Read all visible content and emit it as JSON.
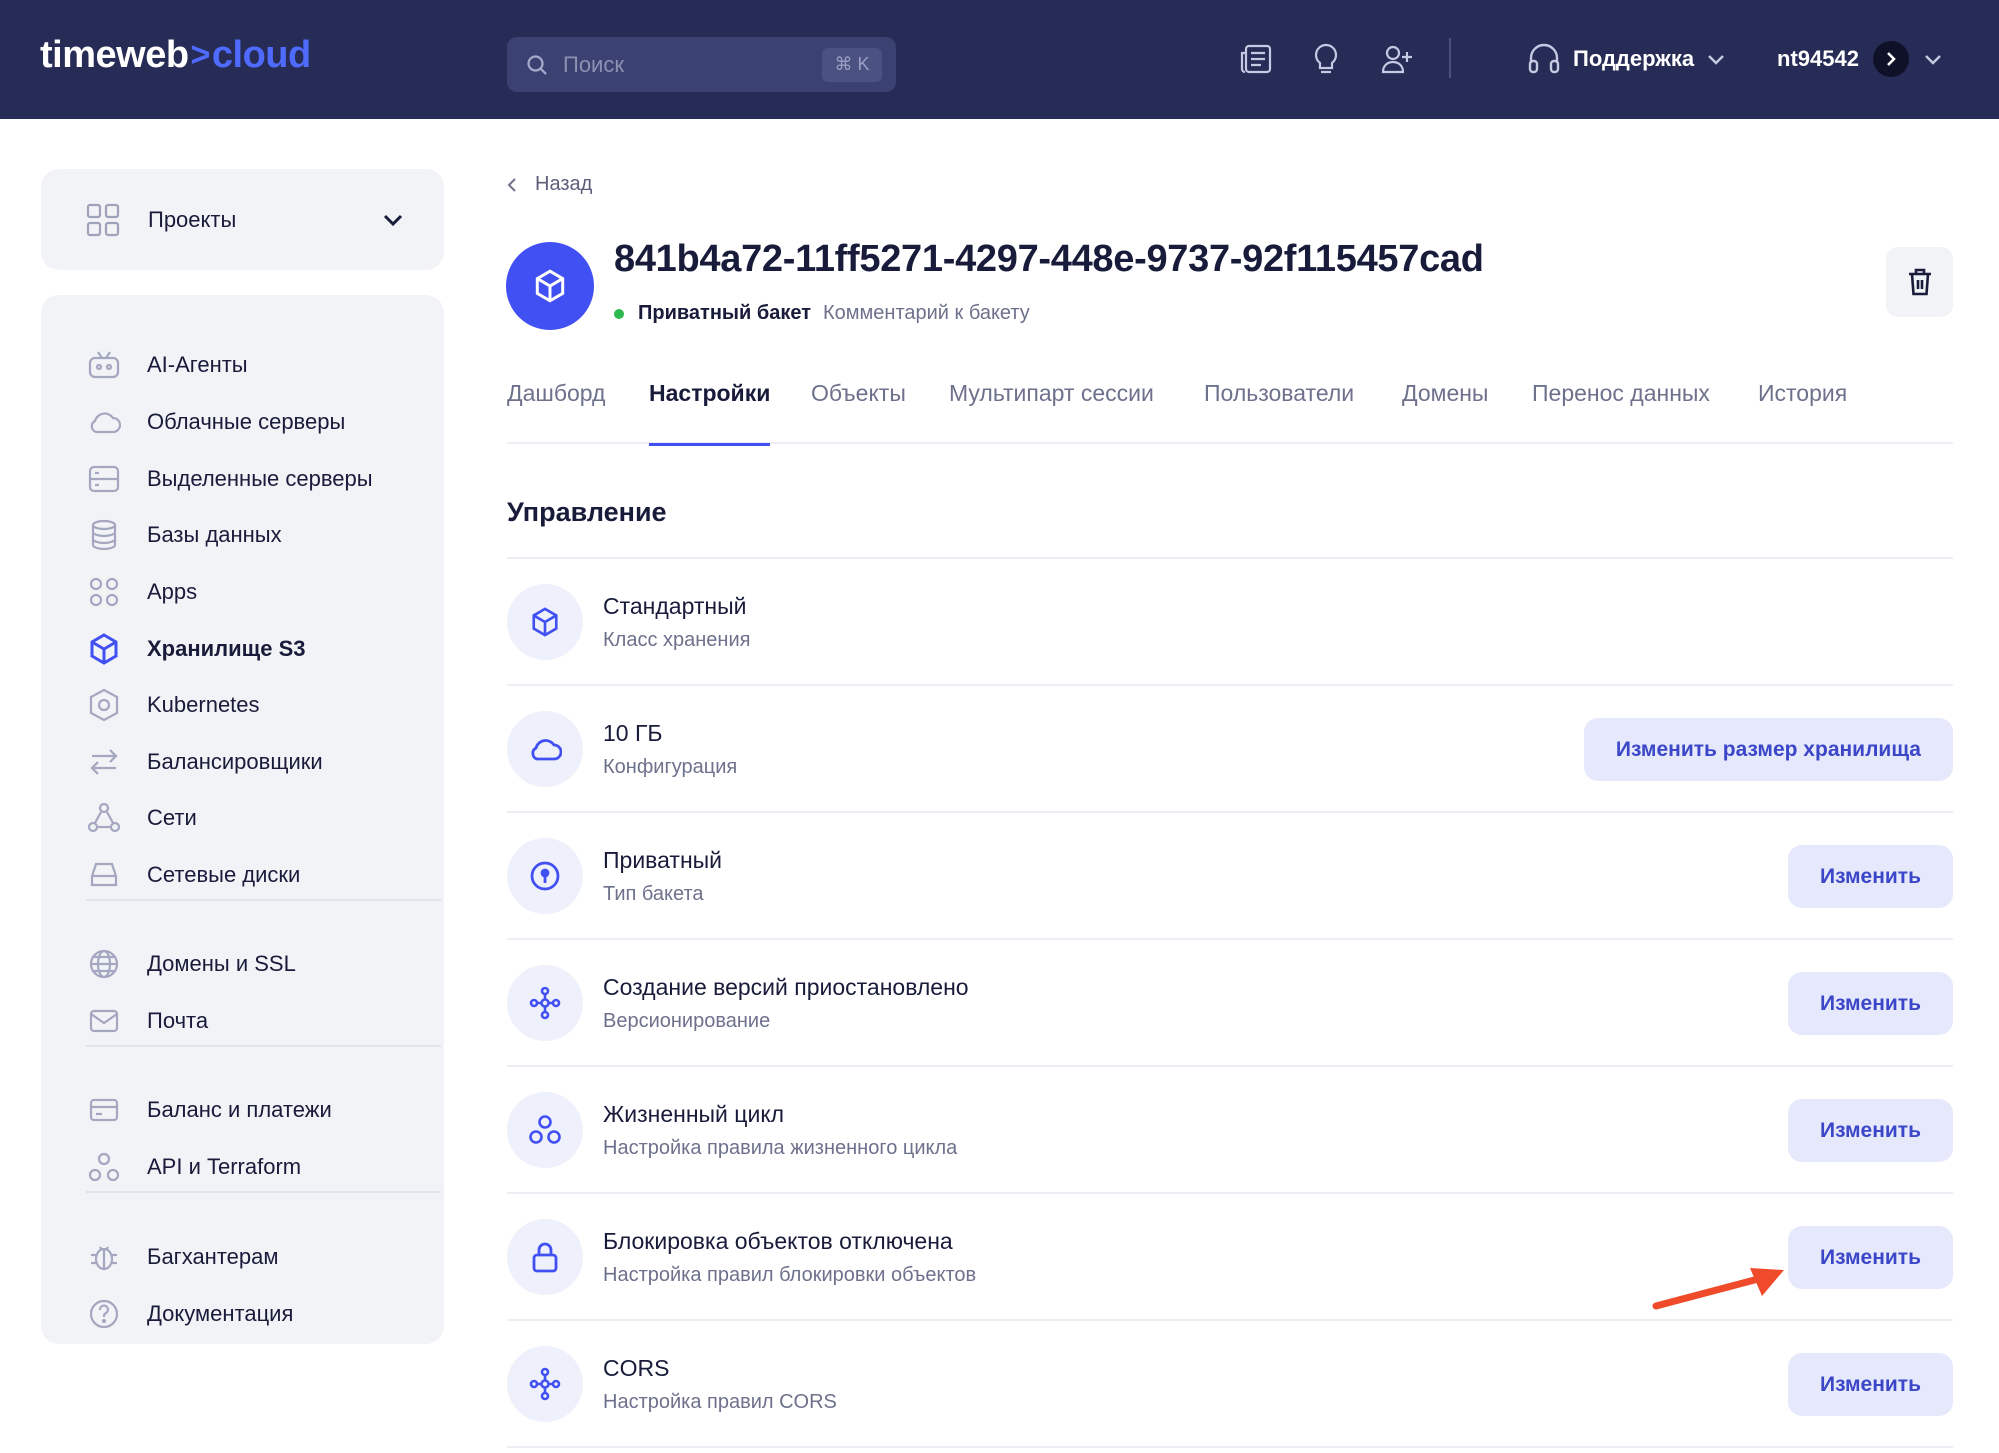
{
  "brand": {
    "name_left": "timeweb",
    "arrow": ">",
    "name_right": "cloud"
  },
  "search": {
    "placeholder": "Поиск",
    "shortcut": "⌘ K"
  },
  "header": {
    "support_label": "Поддержка",
    "username": "nt94542"
  },
  "sidebar": {
    "projects_label": "Проекты",
    "items": [
      {
        "label": "AI-Агенты",
        "icon": "robot-icon"
      },
      {
        "label": "Облачные серверы",
        "icon": "cloud-icon"
      },
      {
        "label": "Выделенные серверы",
        "icon": "server-icon"
      },
      {
        "label": "Базы данных",
        "icon": "database-icon"
      },
      {
        "label": "Apps",
        "icon": "apps-icon"
      },
      {
        "label": "Хранилище S3",
        "icon": "cube-icon",
        "active": true
      },
      {
        "label": "Kubernetes",
        "icon": "kubernetes-icon"
      },
      {
        "label": "Балансировщики",
        "icon": "balancer-icon"
      },
      {
        "label": "Сети",
        "icon": "network-icon"
      },
      {
        "label": "Сетевые диски",
        "icon": "disk-icon"
      },
      {
        "label": "Домены и SSL",
        "icon": "globe-icon"
      },
      {
        "label": "Почта",
        "icon": "mail-icon"
      },
      {
        "label": "Баланс и платежи",
        "icon": "card-icon"
      },
      {
        "label": "API и Terraform",
        "icon": "api-icon"
      },
      {
        "label": "Багхантерам",
        "icon": "bug-icon"
      },
      {
        "label": "Документация",
        "icon": "help-icon"
      }
    ]
  },
  "main": {
    "back_label": "Назад",
    "bucket_id": "841b4a72-11ff5271-4297-448e-9737-92f115457cad",
    "bucket_type": "Приватный бакет",
    "bucket_comment": "Комментарий к бакету",
    "tabs": [
      "Дашборд",
      "Настройки",
      "Объекты",
      "Мультипарт сессии",
      "Пользователи",
      "Домены",
      "Перенос данных",
      "История"
    ],
    "active_tab": "Настройки",
    "section_title": "Управление",
    "rows": [
      {
        "title": "Стандартный",
        "subtitle": "Класс хранения",
        "icon": "cube-icon",
        "button": ""
      },
      {
        "title": "10 ГБ",
        "subtitle": "Конфигурация",
        "icon": "cloud-icon",
        "button": "Изменить размер хранилища"
      },
      {
        "title": "Приватный",
        "subtitle": "Тип бакета",
        "icon": "key-icon",
        "button": "Изменить"
      },
      {
        "title": "Создание версий приостановлено",
        "subtitle": "Версионирование",
        "icon": "share-icon",
        "button": "Изменить"
      },
      {
        "title": "Жизненный цикл",
        "subtitle": "Настройка правила жизненного цикла",
        "icon": "lifecycle-icon",
        "button": "Изменить"
      },
      {
        "title": "Блокировка объектов отключена",
        "subtitle": "Настройка правил блокировки объектов",
        "icon": "lock-icon",
        "button": "Изменить"
      },
      {
        "title": "CORS",
        "subtitle": "Настройка правил CORS",
        "icon": "share-icon",
        "button": "Изменить"
      }
    ]
  },
  "colors": {
    "header_bg": "#262c55",
    "accent": "#4150f2",
    "button_bg": "#e6e8fb",
    "button_text": "#3b47c8",
    "annotation": "#ef4b2a"
  }
}
